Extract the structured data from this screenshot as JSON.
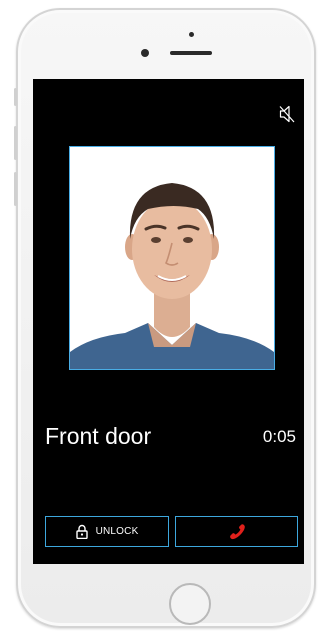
{
  "call": {
    "door_name": "Front door",
    "elapsed": "0:05"
  },
  "actions": {
    "unlock_label": "UNLOCK",
    "unlock_icon": "lock-icon",
    "hangup_icon": "phone-hangup-icon",
    "mute_icon": "speaker-mute-icon"
  },
  "colors": {
    "screen_background": "#000000",
    "accent_border": "#3da7dd",
    "hangup_red": "#e0201b",
    "text": "#ffffff"
  }
}
